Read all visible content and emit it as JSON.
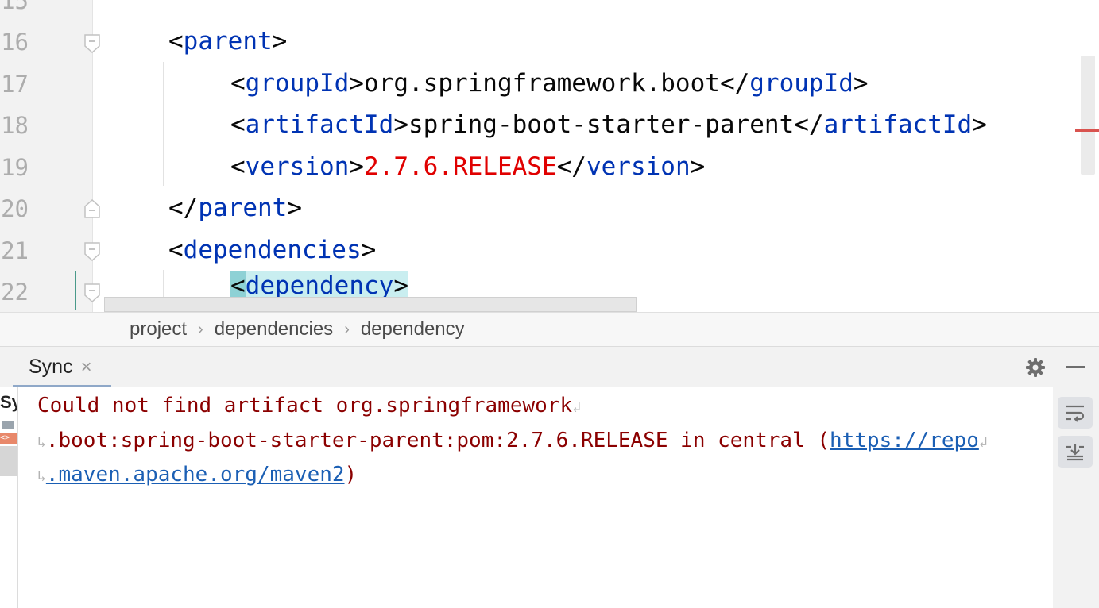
{
  "editor": {
    "line_numbers": [
      "15",
      "16",
      "17",
      "18",
      "19",
      "20",
      "21",
      "22"
    ],
    "lines": {
      "l16": {
        "open": "<",
        "name": "parent",
        "close": ">"
      },
      "l17": {
        "open": "<",
        "name": "groupId",
        "mid": ">",
        "value": "org.springframework.boot",
        "end_open": "</",
        "end_name": "groupId",
        "end_close": ">"
      },
      "l18": {
        "open": "<",
        "name": "artifactId",
        "mid": ">",
        "value": "spring-boot-starter-parent",
        "end_open": "</",
        "end_name": "artifactId",
        "end_close": ">"
      },
      "l19": {
        "open": "<",
        "name": "version",
        "mid": ">",
        "value": "2.7.6.RELEASE",
        "end_open": "</",
        "end_name": "version",
        "end_close": ">"
      },
      "l20": {
        "open": "</",
        "name": "parent",
        "close": ">"
      },
      "l21": {
        "open": "<",
        "name": "dependencies",
        "close": ">"
      },
      "l22": {
        "open": "<",
        "name": "dependency",
        "close": ">"
      }
    }
  },
  "breadcrumbs": [
    "project",
    "dependencies",
    "dependency"
  ],
  "tool_window": {
    "tab_label": "Sync",
    "close_glyph": "×",
    "left_strip_label": "Sy",
    "left_strip_icon_text": "<>"
  },
  "console": {
    "line1": "Could not find artifact org.springframework",
    "line2_text": ".boot:spring-boot-starter-parent:pom:2.7.6.RELEASE in central (",
    "line2_link": "https://repo",
    "line3_link": ".maven.apache.org/maven2",
    "line3_tail": ")",
    "wrap_end": "↲",
    "wrap_start": "↳"
  },
  "colors": {
    "tag": "#0033b3",
    "value_error": "#e00000",
    "console_error": "#8b0000",
    "link": "#1b5fb4"
  },
  "icons": [
    "fold-marker-icon",
    "gear-icon",
    "minimize-icon",
    "soft-wrap-icon",
    "scroll-to-end-icon",
    "close-icon"
  ]
}
